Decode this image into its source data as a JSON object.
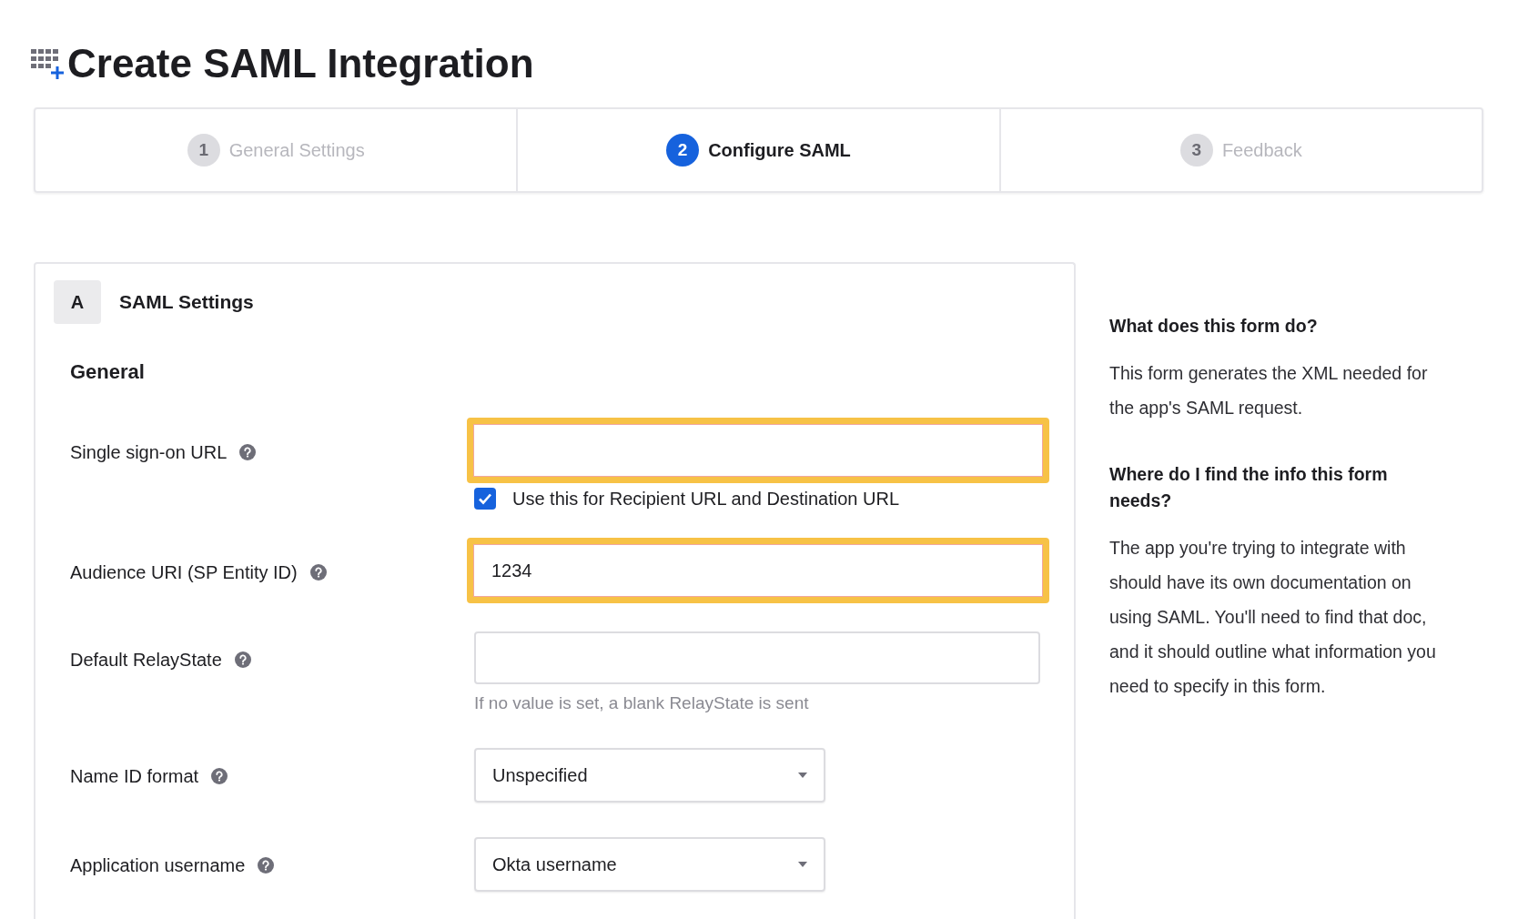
{
  "page": {
    "title": "Create SAML Integration"
  },
  "steps": [
    {
      "number": "1",
      "label": "General Settings",
      "selected": false
    },
    {
      "number": "2",
      "label": "Configure SAML",
      "selected": true
    },
    {
      "number": "3",
      "label": "Feedback",
      "selected": false
    }
  ],
  "section": {
    "badge": "A",
    "title": "SAML Settings",
    "group": "General",
    "fields": [
      {
        "kind": "text",
        "label": "Single sign-on URL",
        "highlighted": true,
        "checkbox": {
          "label": "Use this for Recipient URL and Destination URL",
          "checked": true
        }
      },
      {
        "kind": "text",
        "label": "Audience URI (SP Entity ID)",
        "value": "1234",
        "highlighted": true
      },
      {
        "kind": "text",
        "label": "Default RelayState",
        "highlighted": false,
        "hint": "If no value is set, a blank RelayState is sent"
      },
      {
        "kind": "select",
        "label": "Name ID format",
        "value": "Unspecified"
      },
      {
        "kind": "select",
        "label": "Application username",
        "value": "Okta username"
      }
    ]
  },
  "help": [
    {
      "heading": "What does this form do?",
      "text": "This form generates the XML needed for the app's SAML request."
    },
    {
      "heading": "Where do I find the info this form needs?",
      "text": "The app you're trying to integrate with should have its own documentation on using SAML. You'll need to find that doc, and it should outline what information you need to specify in this form."
    }
  ]
}
